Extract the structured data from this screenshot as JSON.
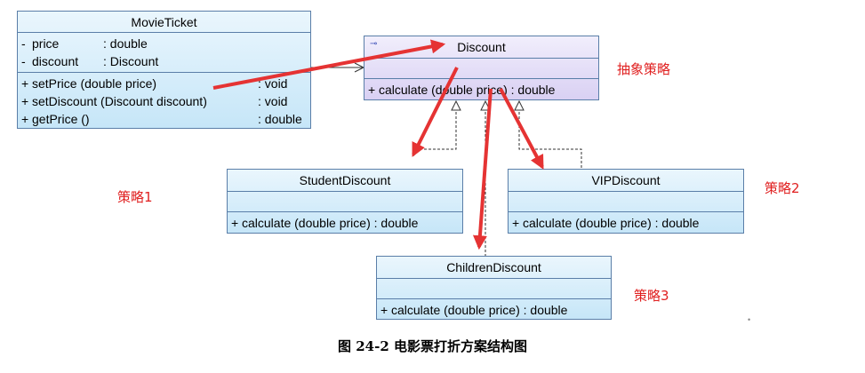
{
  "classes": {
    "movie_ticket": {
      "name": "MovieTicket",
      "attributes": [
        {
          "vis": "-",
          "name": "price",
          "type": ": double"
        },
        {
          "vis": "-",
          "name": "discount",
          "type": ": Discount"
        }
      ],
      "operations": [
        {
          "vis": "+",
          "name": "setPrice (double price)",
          "type": ": void"
        },
        {
          "vis": "+",
          "name": "setDiscount (Discount discount)",
          "type": ": void"
        },
        {
          "vis": "+",
          "name": "getPrice ()",
          "type": ": double"
        }
      ]
    },
    "discount": {
      "name": "Discount",
      "operations": [
        {
          "vis": "+",
          "name": "calculate (double price) : double"
        }
      ]
    },
    "student_discount": {
      "name": "StudentDiscount",
      "operations": [
        {
          "vis": "+",
          "name": "calculate (double price) : double"
        }
      ]
    },
    "vip_discount": {
      "name": "VIPDiscount",
      "operations": [
        {
          "vis": "+",
          "name": "calculate (double price) : double"
        }
      ]
    },
    "children_discount": {
      "name": "ChildrenDiscount",
      "operations": [
        {
          "vis": "+",
          "name": "calculate (double price) : double"
        }
      ]
    }
  },
  "annotations": {
    "abstract_strategy": "抽象策略",
    "strategy1": "策略1",
    "strategy2": "策略2",
    "strategy3": "策略3"
  },
  "caption": "图 24-2  电影票打折方案结构图",
  "colors": {
    "arrow_red": "#e53333",
    "border": "#5a7ea8",
    "label_red": "#e02020"
  }
}
